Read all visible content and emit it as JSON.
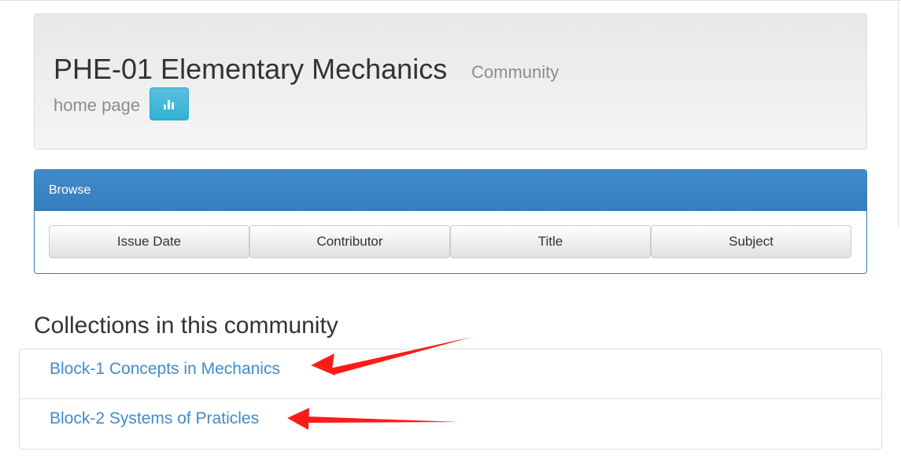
{
  "community": {
    "title": "PHE-01 Elementary Mechanics",
    "subtitle_part1": "Community",
    "subtitle_part2": "home page",
    "stats_icon": "bar-chart-icon"
  },
  "browse": {
    "heading": "Browse",
    "buttons": [
      "Issue Date",
      "Contributor",
      "Title",
      "Subject"
    ]
  },
  "collections": {
    "heading": "Collections in this community",
    "items": [
      {
        "label": "Block-1 Concepts in Mechanics"
      },
      {
        "label": "Block-2 Systems of Praticles"
      }
    ]
  },
  "colors": {
    "link": "#428bca",
    "panel_primary": "#428bca",
    "stats_button": "#5bc0de",
    "annotation_arrow": "#ff0000"
  }
}
